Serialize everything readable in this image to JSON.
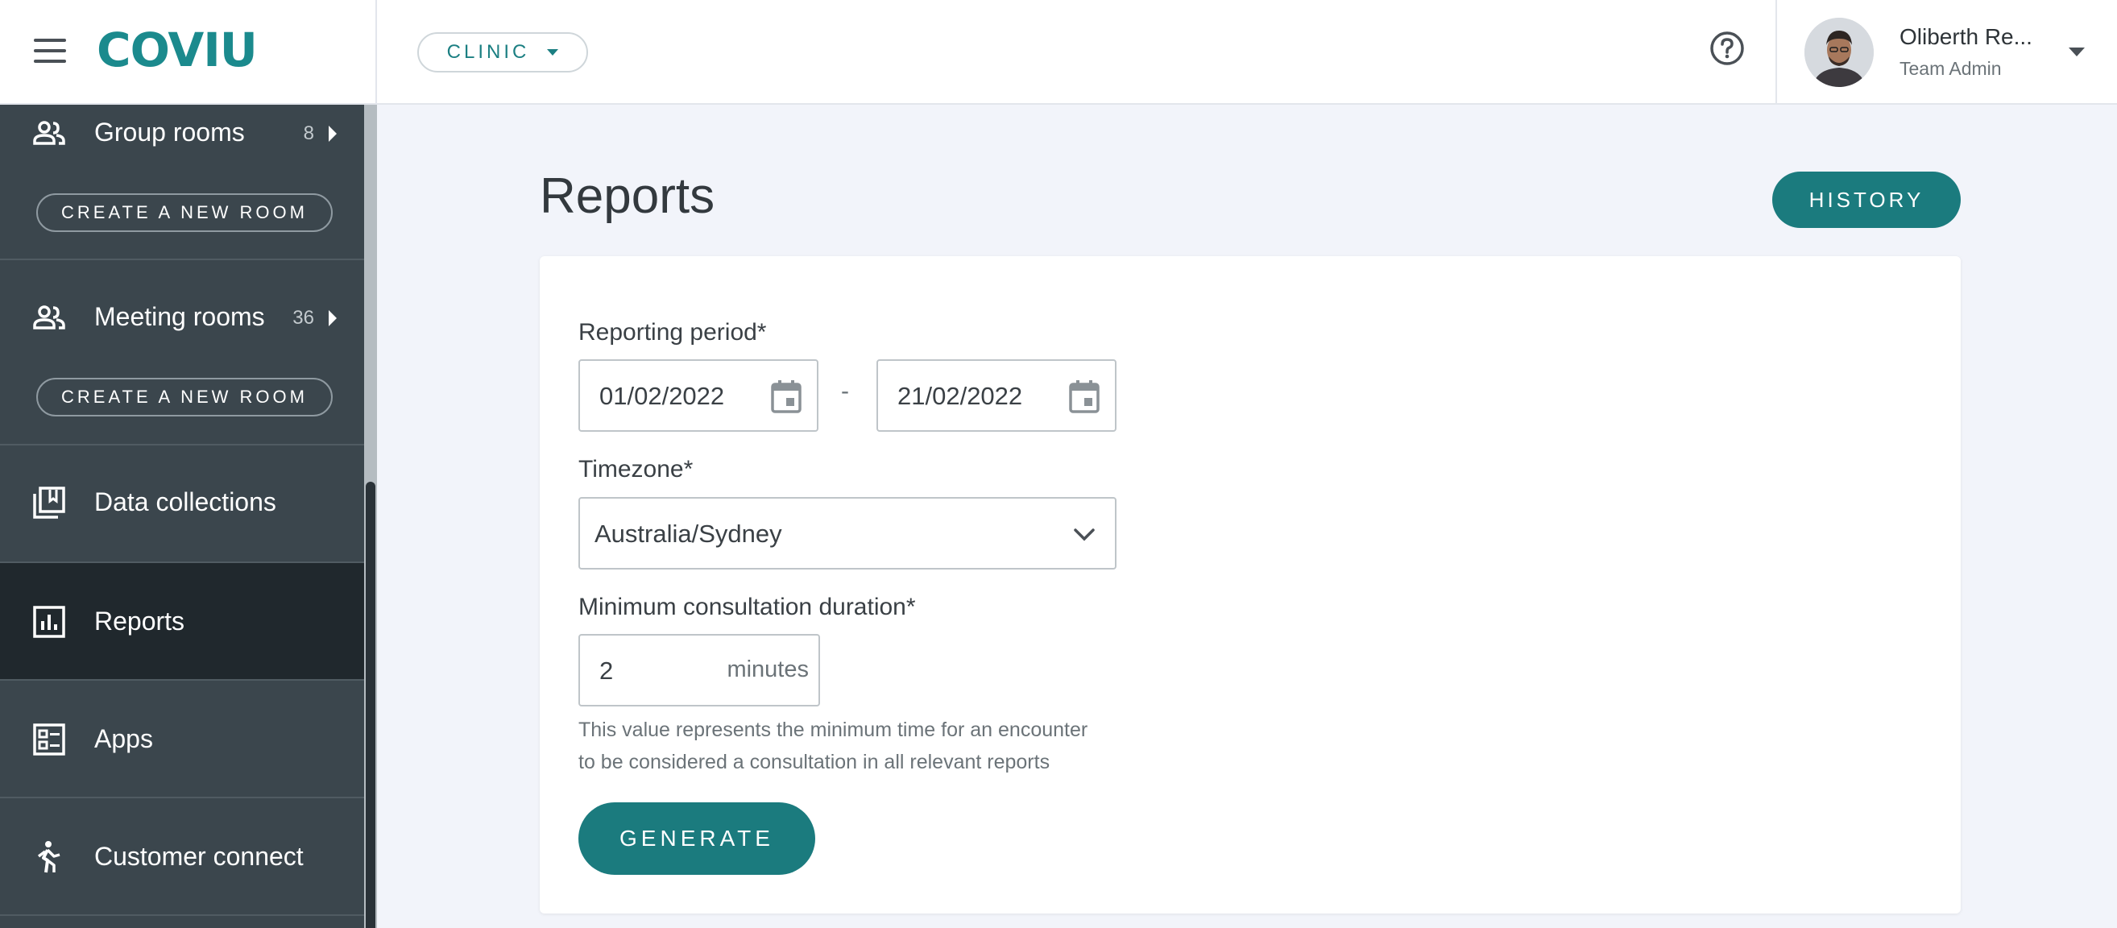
{
  "app": {
    "logo_text": "COVIU",
    "clinic_selector": "CLINIC"
  },
  "user": {
    "name": "Oliberth Re...",
    "role": "Team Admin"
  },
  "sidebar": {
    "sections": [
      {
        "label": "Group rooms",
        "count": "8",
        "icon": "group-icon",
        "action": "CREATE A NEW ROOM"
      },
      {
        "label": "Meeting rooms",
        "count": "36",
        "icon": "group-icon",
        "action": "CREATE A NEW ROOM"
      }
    ],
    "items": [
      {
        "label": "Data collections",
        "icon": "collections-icon"
      },
      {
        "label": "Reports",
        "icon": "chart-icon",
        "active": true
      },
      {
        "label": "Apps",
        "icon": "apps-icon"
      },
      {
        "label": "Customer connect",
        "icon": "person-walking-icon"
      }
    ]
  },
  "main": {
    "title": "Reports",
    "history_label": "HISTORY",
    "form": {
      "period_label": "Reporting period*",
      "start_date": "01/02/2022",
      "separator": "-",
      "end_date": "21/02/2022",
      "timezone_label": "Timezone*",
      "timezone_value": "Australia/Sydney",
      "duration_label": "Minimum consultation duration*",
      "duration_value": "2",
      "duration_unit": "minutes",
      "help_line1": "This value represents the minimum time for an encounter",
      "help_line2": "to be considered a consultation in all relevant reports",
      "generate_label": "GENERATE"
    }
  },
  "colors": {
    "accent": "#1b7b7e",
    "sidebar_bg": "#3b464d",
    "sidebar_active": "#20282d",
    "page_bg": "#f2f4fa"
  }
}
